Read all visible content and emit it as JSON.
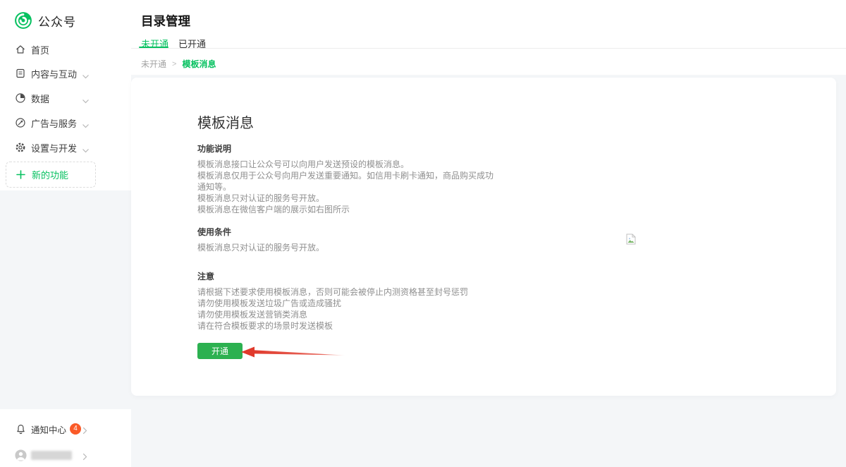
{
  "brand": {
    "name": "公众号"
  },
  "sidebar": {
    "items": [
      {
        "label": "首页",
        "icon": "home-icon",
        "expandable": false
      },
      {
        "label": "内容与互动",
        "icon": "document-icon",
        "expandable": true
      },
      {
        "label": "数据",
        "icon": "pie-chart-icon",
        "expandable": true
      },
      {
        "label": "广告与服务",
        "icon": "compass-icon",
        "expandable": true
      },
      {
        "label": "设置与开发",
        "icon": "gear-icon",
        "expandable": true
      }
    ],
    "new_feature_label": "新的功能",
    "notification": {
      "label": "通知中心",
      "badge": "4"
    }
  },
  "header": {
    "title": "目录管理",
    "tabs": [
      {
        "label": "未开通",
        "active": true
      },
      {
        "label": "已开通",
        "active": false
      }
    ]
  },
  "breadcrumb": {
    "parent": "未开通",
    "separator": ">",
    "current": "模板消息"
  },
  "main": {
    "title": "模板消息",
    "sections": [
      {
        "heading": "功能说明",
        "lines": [
          "模板消息接口让公众号可以向用户发送预设的模板消息。",
          "模板消息仅用于公众号向用户发送重要通知。如信用卡刷卡通知，商品购买成功",
          "通知等。",
          "模板消息只对认证的服务号开放。",
          "模板消息在微信客户端的展示如右图所示"
        ]
      },
      {
        "heading": "使用条件",
        "lines": [
          "模板消息只对认证的服务号开放。"
        ]
      },
      {
        "heading": "注意",
        "lines": [
          "请根据下述要求使用模板消息，否则可能会被停止内测资格甚至封号惩罚",
          "请勿使用模板发送垃圾广告或造成骚扰",
          "请勿使用模板发送营销类消息",
          "请在符合模板要求的场景时发送模板"
        ]
      }
    ],
    "open_button": "开通"
  },
  "colors": {
    "accent_green": "#07c160",
    "button_green": "#2cb150",
    "arrow_red": "#e03a2c",
    "badge_orange": "#fa5a28"
  }
}
